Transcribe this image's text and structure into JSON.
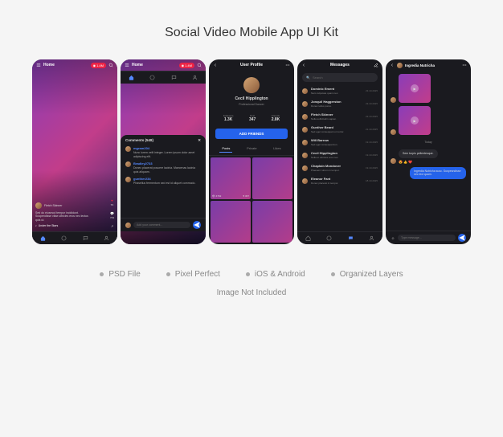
{
  "title": "Social Video Mobile App UI Kit",
  "colors": {
    "accent": "#2563eb",
    "bg": "#1a1a1f",
    "heart": "#ee2244"
  },
  "feed": {
    "header_title": "Home",
    "live_badge": "1.4M",
    "user": "Fletch Skinner",
    "description": "Sed do eiusmod tempor incididunt. Suspendisse vitae ultricies eros nec lectus quis ut.",
    "music": "Under the Stars",
    "actions": {
      "likes": "7K",
      "comments": "743",
      "shares": ""
    }
  },
  "comments": {
    "header": "Comments (548)",
    "list": [
      {
        "user": "mgram204",
        "text": "Nunc lorem velit integer. Lorem ipsum dolor amet adipiscing elit."
      },
      {
        "user": "Bradley2733",
        "text": "Donec placerat posuere lacinia. Maecenas lacinia quis aliquam."
      },
      {
        "user": "gunther234",
        "text": "Phasellus fermentum sed est id aliquet commodo."
      }
    ],
    "input_placeholder": "Add your comment..."
  },
  "profile": {
    "header": "User Profile",
    "name": "Cecil Hipplington",
    "role": "Professional Dancer",
    "stats": [
      {
        "label": "Followers",
        "value": "1.3K"
      },
      {
        "label": "Post",
        "value": "347"
      },
      {
        "label": "Friends",
        "value": "2.8K"
      }
    ],
    "add_friends": "ADD FRIENDS",
    "tabs": [
      "Posts",
      "Private",
      "Likes"
    ],
    "grid": [
      {
        "views": "4762",
        "likes": "367"
      },
      {
        "views": "",
        "likes": ""
      },
      {
        "views": "",
        "likes": ""
      },
      {
        "views": "",
        "likes": ""
      }
    ]
  },
  "messages": {
    "header": "Messages",
    "search_placeholder": "Search",
    "list": [
      {
        "name": "Dominic Ement",
        "preview": "Nam vulputate quam nec.",
        "date": "23.10.2025"
      },
      {
        "name": "Jonquil Haggerston",
        "preview": "Donec tellus purus.",
        "date": "23.10.2025"
      },
      {
        "name": "Fletch Skinner",
        "preview": "Nulla sollicitudin sapien.",
        "date": "23.10.2025"
      },
      {
        "name": "Gunther Beard",
        "preview": "Sed eget consequat non tortor.",
        "date": "21.10.2025"
      },
      {
        "name": "Will Barrow",
        "preview": "Sed eget consequat don.",
        "date": "19.10.2025"
      },
      {
        "name": "Cecil Hipplington",
        "preview": "Nulla et ultricies eros nec.",
        "date": "19.10.2025"
      },
      {
        "name": "Chaplain Mondover",
        "preview": "Praesent rutrum in tempor.",
        "date": "19.10.2025"
      },
      {
        "name": "Eleanor Fant",
        "preview": "Donec placerat in tempor.",
        "date": "18.10.2025"
      }
    ]
  },
  "chat": {
    "header_name": "Ingredia Nutricha",
    "day": "Today",
    "bubbles": [
      {
        "dir": "in",
        "text": "Sem turpis pellentesque."
      },
      {
        "dir": "out",
        "text": "Ingredia Nutricha susc. Suspesndisse nec lect quam."
      }
    ],
    "input_placeholder": "Type message..."
  },
  "features": [
    "PSD File",
    "Pixel Perfect",
    "iOS & Android",
    "Organized Layers"
  ],
  "footnote": "Image Not Included"
}
